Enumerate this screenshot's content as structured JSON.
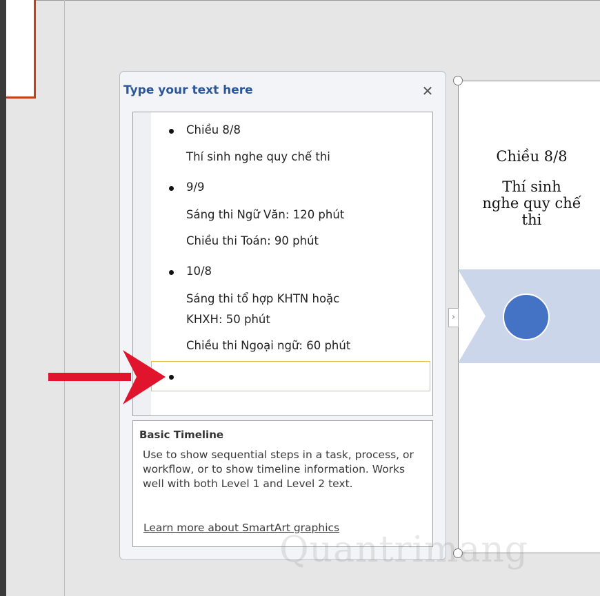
{
  "pane": {
    "title": "Type your text here",
    "close_glyph": "✕",
    "items": [
      {
        "bullet": "Chiều 8/8",
        "subs": [
          "Thí sinh nghe quy chế thi"
        ]
      },
      {
        "bullet": "9/9",
        "subs": [
          "Sáng thi Ngữ Văn: 120  phút",
          "Chiều thi Toán: 90 phút"
        ]
      },
      {
        "bullet": "10/8",
        "subs": [
          "Sáng thi tổ hợp KHTN hoặc",
          "KHXH: 50 phút",
          "Chiều thi Ngoại ngữ: 60 phút"
        ]
      }
    ],
    "info_title": "Basic Timeline",
    "info_desc": "Use to show sequential steps in a task, process, or workflow, or to show timeline information. Works well with both Level 1 and Level 2 text.",
    "info_link": "Learn more about SmartArt graphics"
  },
  "canvas": {
    "heading": "Chiều 8/8",
    "body_lines": [
      "Thí sinh",
      "nghe quy chế",
      "thi"
    ],
    "expand_glyph": "›"
  },
  "colors": {
    "title": "#2b579a",
    "circle": "#4472c4",
    "band": "#ccd6ea",
    "arrow": "#e0152d",
    "active_border": "#f0b94a",
    "slide_border": "#c0411b"
  },
  "icons": [
    "close-icon",
    "expand-chevron-icon",
    "arrow-annotation-icon"
  ]
}
